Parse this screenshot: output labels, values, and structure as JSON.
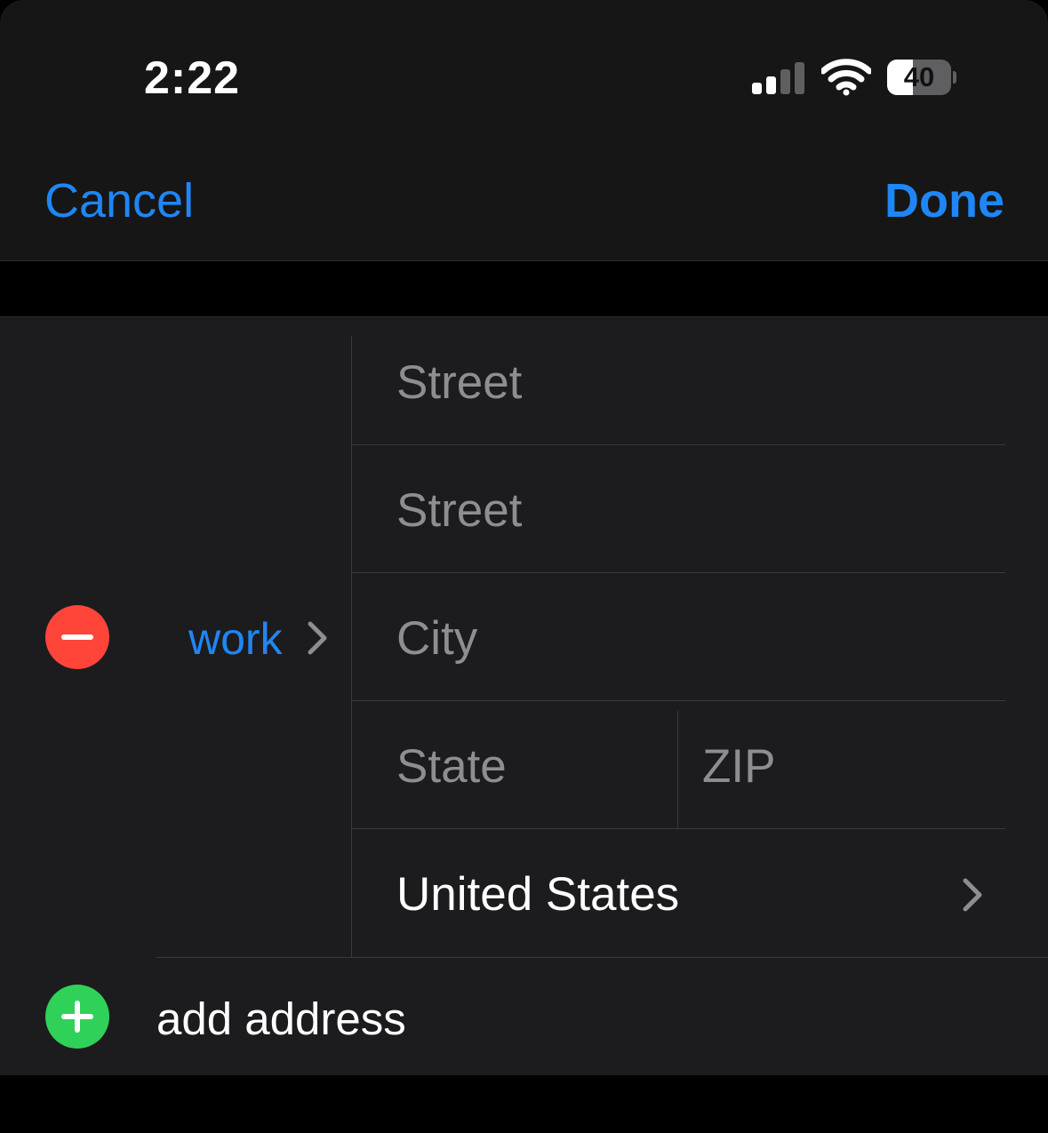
{
  "status_bar": {
    "time": "2:22",
    "battery_level": "40",
    "battery_percent": 40,
    "signal_bars_active": 2,
    "signal_bars_total": 4
  },
  "nav": {
    "cancel_label": "Cancel",
    "done_label": "Done"
  },
  "address": {
    "label": "work",
    "street1_placeholder": "Street",
    "street2_placeholder": "Street",
    "city_placeholder": "City",
    "state_placeholder": "State",
    "zip_placeholder": "ZIP",
    "country": "United States"
  },
  "add_address_label": "add address",
  "colors": {
    "accent_blue": "#1f86f5",
    "delete_red": "#ff453a",
    "add_green": "#30d158",
    "placeholder_gray": "#8d8d93",
    "cell_background": "#1c1c1e"
  }
}
